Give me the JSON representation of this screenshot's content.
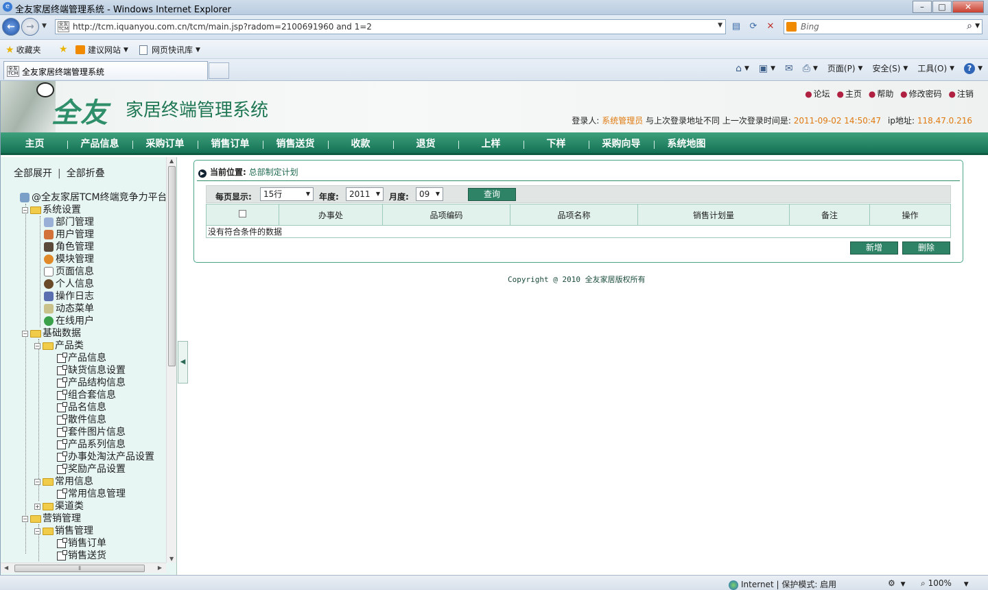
{
  "browser": {
    "window_title": "全友家居终端管理系统 - Windows Internet Explorer",
    "address": "http://tcm.iquanyou.com.cn/tcm/main.jsp?radom=2100691960 and 1=2",
    "favicon_text": "全友 TCM",
    "search_placeholder": "Bing",
    "favorites_label": "收藏夹",
    "favorites_items": [
      "建议网站",
      "网页快讯库"
    ],
    "tab_title": "全友家居终端管理系统",
    "command_bar": [
      "页面(P)",
      "安全(S)",
      "工具(O)"
    ],
    "status_zone": "Internet | 保护模式: 启用",
    "zoom": "100%"
  },
  "header": {
    "logo_main": "全友",
    "logo_sub": "家居终端管理系统",
    "top_links": [
      "论坛",
      "主页",
      "帮助",
      "修改密码",
      "注销"
    ],
    "login_label": "登录人:",
    "login_user": "系统管理员",
    "login_mid": "与上次登录地址不同 上一次登录时间是:",
    "login_time": "2011-09-02 14:50:47",
    "ip_label": "ip地址:",
    "ip": "118.47.0.216"
  },
  "nav": [
    "主页",
    "产品信息",
    "采购订单",
    "销售订单",
    "销售送货",
    "收款",
    "退货",
    "上样",
    "下样",
    "采购向导",
    "系统地图"
  ],
  "sidebar": {
    "expand_all": "全部展开",
    "collapse_all": "全部折叠",
    "tree": {
      "root": "@全友家居TCM终端竞争力平台",
      "n0": "系统设置",
      "n1": "部门管理",
      "n2": "用户管理",
      "n3": "角色管理",
      "n4": "模块管理",
      "n5": "页面信息",
      "n6": "个人信息",
      "n7": "操作日志",
      "n8": "动态菜单",
      "n9": "在线用户",
      "n10": "基础数据",
      "n11": "产品类",
      "n12": "产品信息",
      "n13": "缺货信息设置",
      "n14": "产品结构信息",
      "n15": "组合套信息",
      "n16": "品名信息",
      "n17": "散件信息",
      "n18": "套件图片信息",
      "n19": "产品系列信息",
      "n20": "办事处淘汰产品设置",
      "n21": "奖励产品设置",
      "n22": "常用信息",
      "n23": "常用信息管理",
      "n24": "渠道类",
      "n25": "营销管理",
      "n26": "销售管理",
      "n27": "销售订单",
      "n28": "销售送货"
    }
  },
  "content": {
    "location_label": "当前位置:",
    "location_path": "总部制定计划",
    "filters": {
      "page_size_label": "每页显示:",
      "page_size": "15行",
      "year_label": "年度:",
      "year": "2011",
      "month_label": "月度:",
      "month": "09",
      "query_button": "查询"
    },
    "table": {
      "headers": [
        "办事处",
        "品项编码",
        "品项名称",
        "销售计划量",
        "备注",
        "操作"
      ],
      "empty_message": "没有符合条件的数据"
    },
    "add_button": "新增",
    "delete_button": "删除",
    "copyright": "Copyright @ 2010 全友家居版权所有"
  },
  "colors": {
    "nav_green": "#147254",
    "accent_orange": "#e07a10",
    "button_green": "#2e8366"
  }
}
